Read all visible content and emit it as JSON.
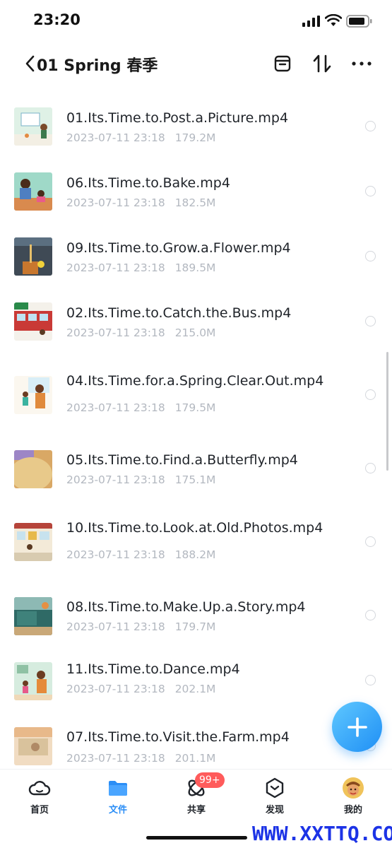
{
  "status_bar": {
    "time": "23:20"
  },
  "header": {
    "title": "01 Spring 春季"
  },
  "files": [
    {
      "name": "01.Its.Time.to.Post.a.Picture.mp4",
      "date": "2023-07-11 23:18",
      "size": "179.2M"
    },
    {
      "name": "06.Its.Time.to.Bake.mp4",
      "date": "2023-07-11 23:18",
      "size": "182.5M"
    },
    {
      "name": "09.Its.Time.to.Grow.a.Flower.mp4",
      "date": "2023-07-11 23:18",
      "size": "189.5M"
    },
    {
      "name": "02.Its.Time.to.Catch.the.Bus.mp4",
      "date": "2023-07-11 23:18",
      "size": "215.0M"
    },
    {
      "name": "04.Its.Time.for.a.Spring.Clear.Out.mp4",
      "date": "2023-07-11 23:18",
      "size": "179.5M"
    },
    {
      "name": "05.Its.Time.to.Find.a.Butterfly.mp4",
      "date": "2023-07-11 23:18",
      "size": "175.1M"
    },
    {
      "name": "10.Its.Time.to.Look.at.Old.Photos.mp4",
      "date": "2023-07-11 23:18",
      "size": "188.2M"
    },
    {
      "name": "08.Its.Time.to.Make.Up.a.Story.mp4",
      "date": "2023-07-11 23:18",
      "size": "179.7M"
    },
    {
      "name": "11.Its.Time.to.Dance.mp4",
      "date": "2023-07-11 23:18",
      "size": "202.1M"
    },
    {
      "name": "07.Its.Time.to.Visit.the.Farm.mp4",
      "date": "2023-07-11 23:18",
      "size": "201.1M"
    }
  ],
  "tabbar": {
    "home": "首页",
    "files": "文件",
    "share": "共享",
    "share_badge": "99+",
    "discover": "发现",
    "mine": "我的"
  },
  "colors": {
    "accent": "#2b8ef6",
    "badge": "#ff5b5b",
    "meta": "#b3b8c0"
  },
  "watermark": "WWW.XXTTQ.COM"
}
